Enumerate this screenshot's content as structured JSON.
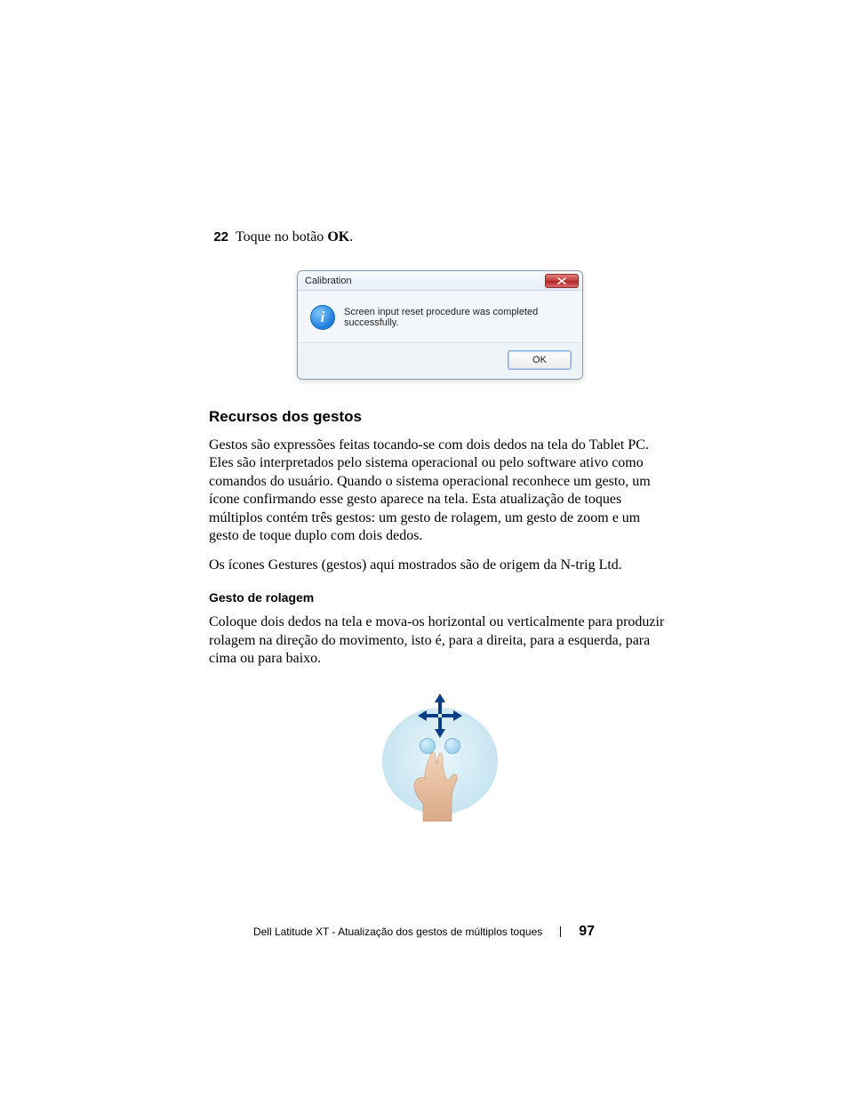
{
  "step": {
    "number": "22",
    "text_before": "Toque no botão ",
    "text_bold": "OK",
    "text_after": "."
  },
  "dialog": {
    "title": "Calibration",
    "message": "Screen input reset procedure was completed successfully.",
    "ok_label": "OK"
  },
  "section": {
    "heading": "Recursos dos gestos",
    "para1": "Gestos são expressões feitas tocando-se com dois dedos na tela do Tablet PC. Eles são interpretados pelo sistema operacional ou pelo software ativo como comandos do usuário. Quando o sistema operacional reconhece um gesto, um ícone confirmando esse gesto aparece na tela. Esta atualização de toques múltiplos contém três gestos: um gesto de rolagem, um gesto de zoom e um gesto de toque duplo com dois dedos.",
    "para2": "Os ícones Gestures (gestos) aqui mostrados são de origem da N-trig Ltd."
  },
  "subsection": {
    "heading": "Gesto de rolagem",
    "para": "Coloque dois dedos na tela e mova-os horizontal ou verticalmente para produzir rolagem na direção do movimento, isto é, para a direita, para a esquerda, para cima ou para baixo."
  },
  "footer": {
    "title": "Dell Latitude XT - Atualização dos gestos de múltiplos toques",
    "page": "97"
  }
}
